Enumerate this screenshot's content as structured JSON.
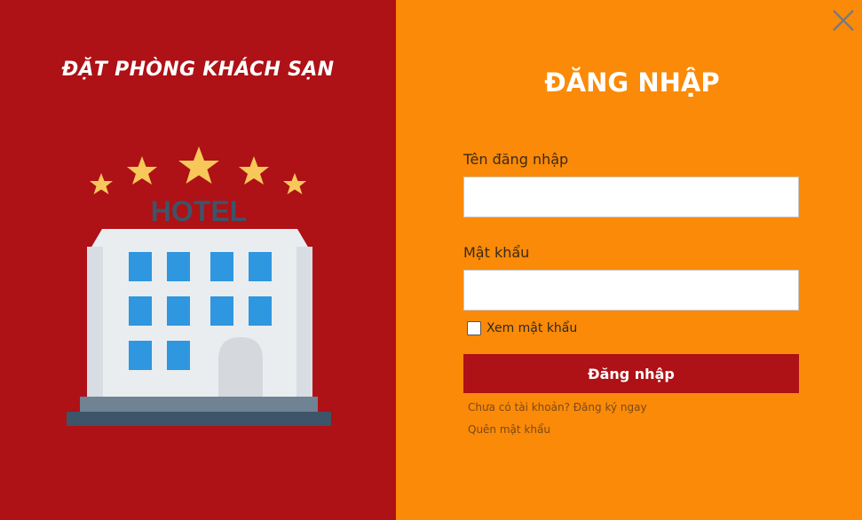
{
  "left": {
    "title": "ĐẶT PHÒNG KHÁCH SẠN",
    "hotel_sign": "HOTEL"
  },
  "login": {
    "title": "ĐĂNG NHẬP",
    "username_label": "Tên đăng nhập",
    "username_value": "",
    "password_label": "Mật khẩu",
    "password_value": "",
    "show_password_label": "Xem mật khẩu",
    "show_password_checked": false,
    "submit_label": "Đăng nhập",
    "register_link": "Chưa có tài khoản? Đăng ký ngay",
    "forgot_link": "Quên mật khẩu"
  },
  "colors": {
    "left_bg": "#ae1116",
    "right_bg": "#fa8a07",
    "button_bg": "#ae1116",
    "star": "#f7c75a",
    "window_blue": "#2f96e0"
  },
  "icons": {
    "close": "close-icon",
    "stars": "star-icon",
    "building": "hotel-building-icon"
  }
}
